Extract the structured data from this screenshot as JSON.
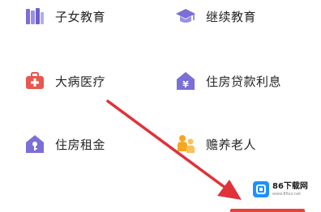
{
  "items": [
    {
      "label": "子女教育",
      "icon": "books-icon"
    },
    {
      "label": "继续教育",
      "icon": "graduation-cap-icon"
    },
    {
      "label": "大病医疗",
      "icon": "medical-kit-icon"
    },
    {
      "label": "住房贷款利息",
      "icon": "house-yen-icon"
    },
    {
      "label": "住房租金",
      "icon": "house-key-icon"
    },
    {
      "label": "赡养老人",
      "icon": "elderly-care-icon"
    }
  ],
  "watermark": {
    "title": "86下载网",
    "subtitle": "www.86xz.net"
  },
  "colors": {
    "accent_purple": "#7b6fd6",
    "medical_red": "#e8574d",
    "arrow_red": "#e0323a",
    "elderly_orange": "#f5a623"
  }
}
